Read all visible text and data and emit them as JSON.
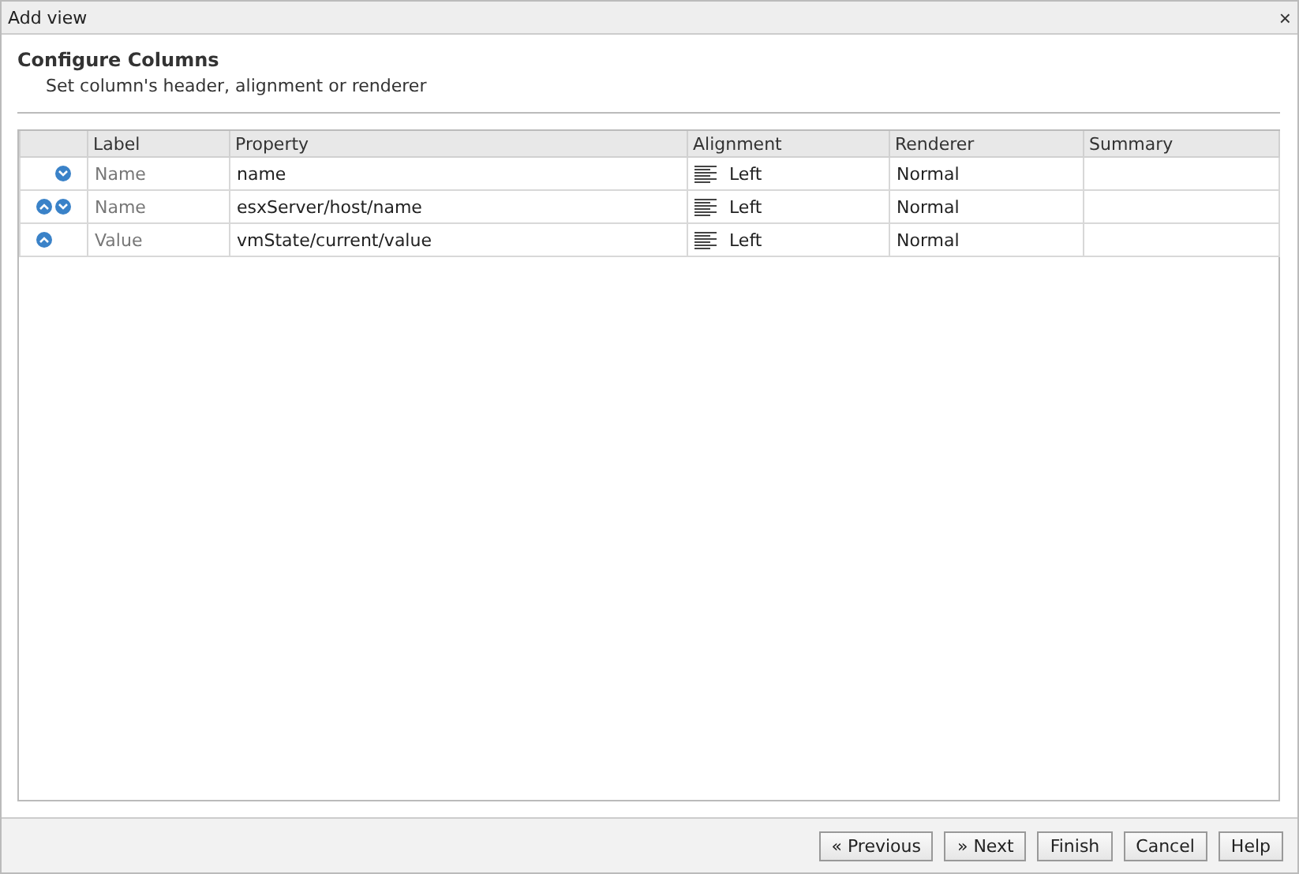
{
  "window": {
    "title": "Add view",
    "close": "×"
  },
  "header": {
    "title": "Configure Columns",
    "subtitle": "Set column's header, alignment or renderer"
  },
  "table": {
    "columns": [
      "Label",
      "Property",
      "Alignment",
      "Renderer",
      "Summary"
    ],
    "rows": [
      {
        "can_move_up": false,
        "can_move_down": true,
        "label": "Name",
        "property": "name",
        "alignment": "Left",
        "renderer": "Normal"
      },
      {
        "can_move_up": true,
        "can_move_down": true,
        "label": "Name",
        "property": "esxServer/host/name",
        "alignment": "Left",
        "renderer": "Normal"
      },
      {
        "can_move_up": true,
        "can_move_down": false,
        "label": "Value",
        "property": "vmState/current/value",
        "alignment": "Left",
        "renderer": "Normal"
      }
    ]
  },
  "buttons": [
    "« Previous",
    "» Next",
    "Finish",
    "Cancel",
    "Help"
  ]
}
